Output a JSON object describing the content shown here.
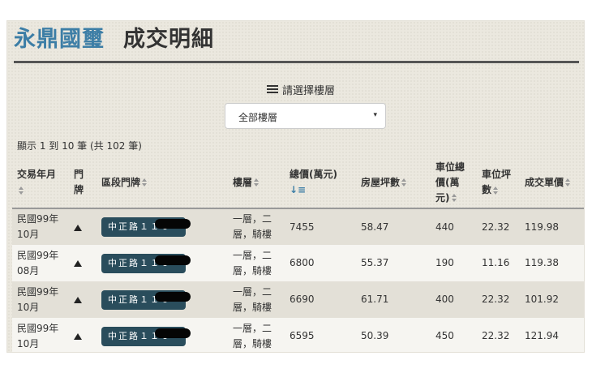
{
  "header": {
    "brand": "永鼎國璽",
    "title": "成交明細"
  },
  "floor_filter": {
    "label": "請選擇樓層",
    "selected": "全部樓層",
    "arrow": "▾"
  },
  "summary": "顯示 1 到 10 筆 (共 102 筆)",
  "table": {
    "columns": [
      "交易年月",
      "門牌",
      "區段門牌",
      "樓層",
      "總價(萬元)",
      "房屋坪數",
      "車位總價(萬元)",
      "車位坪數",
      "成交單價"
    ],
    "rows": [
      {
        "date": "民國99年10月",
        "address": "中正路１１０",
        "floor": "一層，二層，騎樓",
        "total": "7455",
        "area": "58.47",
        "parking_price": "440",
        "parking_area": "22.32",
        "unit_price": "119.98"
      },
      {
        "date": "民國99年08月",
        "address": "中正路１１０",
        "floor": "一層，二層，騎樓",
        "total": "6800",
        "area": "55.37",
        "parking_price": "190",
        "parking_area": "11.16",
        "unit_price": "119.38"
      },
      {
        "date": "民國99年10月",
        "address": "中正路１１０",
        "floor": "一層，二層，騎樓",
        "total": "6690",
        "area": "61.71",
        "parking_price": "400",
        "parking_area": "22.32",
        "unit_price": "101.92"
      },
      {
        "date": "民國99年10月",
        "address": "中正路１１０",
        "floor": "一層，二層，騎樓",
        "total": "6595",
        "area": "50.39",
        "parking_price": "450",
        "parking_area": "22.32",
        "unit_price": "121.94"
      }
    ]
  },
  "icons": {
    "menu": "menu-icon",
    "map": "map-marker-icon",
    "sort": "sort-icon",
    "sort_desc": "sort-desc-icon"
  },
  "colors": {
    "brand": "#3d7ea6",
    "address_badge": "#2a4d5c",
    "background": "#ebe8df"
  }
}
